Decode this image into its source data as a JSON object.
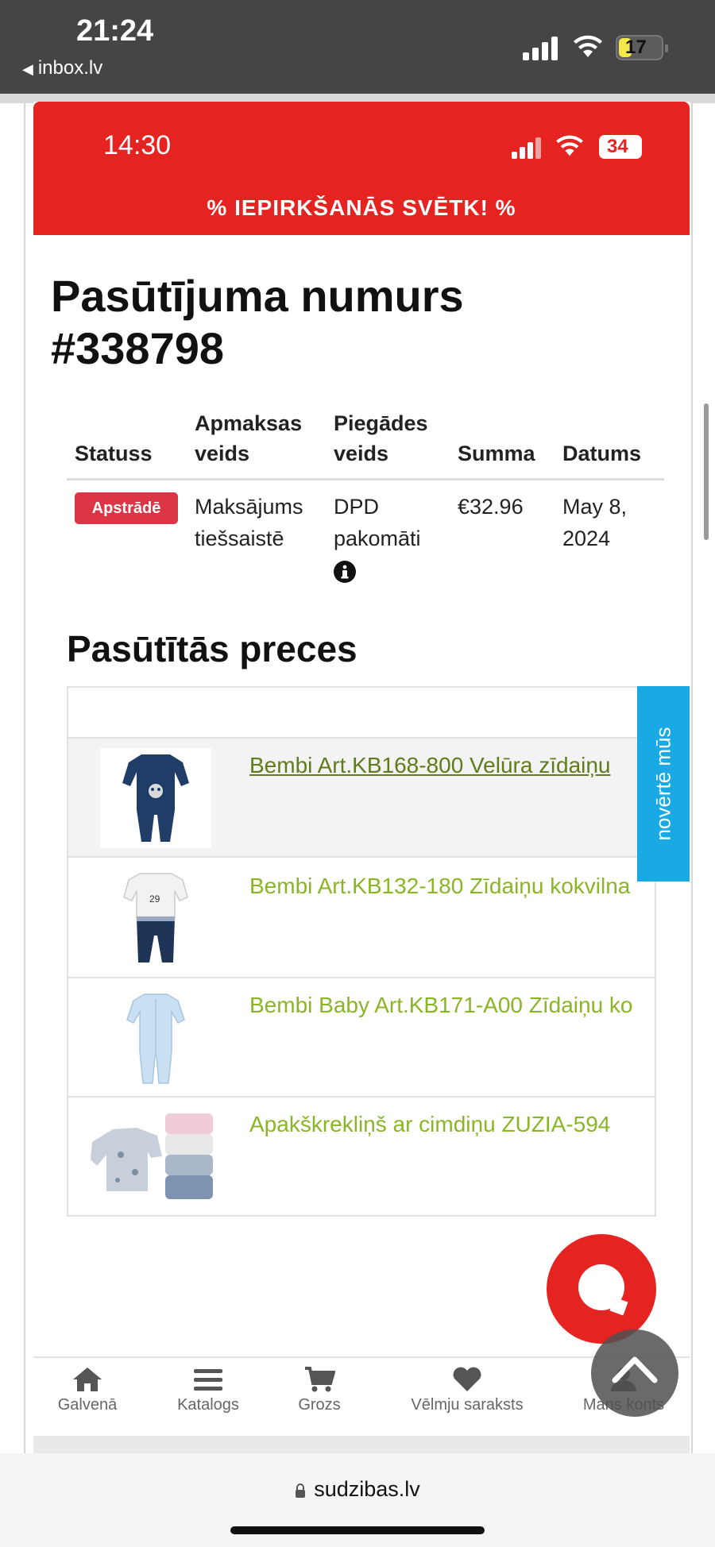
{
  "outer_status": {
    "time": "21:24",
    "back_app": "inbox.lv",
    "battery": "17"
  },
  "inner_status": {
    "time": "14:30",
    "battery": "34"
  },
  "promo_banner": "% IEPIRKŠANĀS SVĒTK! %",
  "order": {
    "title_line1": "Pasūtījuma numurs",
    "title_line2": "#338798",
    "headers": {
      "status": "Statuss",
      "payment_line1": "Apmaksas",
      "payment_line2": "veids",
      "delivery_line1": "Piegādes",
      "delivery_line2": "veids",
      "sum": "Summa",
      "date": "Datums"
    },
    "status_badge": "Apstrādē",
    "payment_line1": "Maksājums",
    "payment_line2": "tiešsaistē",
    "delivery_line1": "DPD",
    "delivery_line2": "pakomāti",
    "sum": "€32.96",
    "date_line1": "May 8,",
    "date_line2": "2024"
  },
  "products": {
    "title": "Pasūtītās preces",
    "items": [
      {
        "name": "Bembi Art.KB168-800 Velūra zīdaiņu"
      },
      {
        "name": "Bembi Art.KB132-180 Zīdaiņu kokvilna"
      },
      {
        "name": "Bembi Baby Art.KB171-A00 Zīdaiņu ko"
      },
      {
        "name": "Apakškrekliņš ar cimdiņu ZUZIA-594"
      }
    ]
  },
  "rate_tab": "novērtē mūs",
  "bottom_nav": [
    {
      "label": "Galvenā",
      "icon": "home-icon"
    },
    {
      "label": "Katalogs",
      "icon": "menu-icon"
    },
    {
      "label": "Grozs",
      "icon": "cart-icon"
    },
    {
      "label": "Vēlmju saraksts",
      "icon": "heart-icon"
    },
    {
      "label": "Mans konts",
      "icon": "user-icon"
    }
  ],
  "url": "sudzibas.lv",
  "colors": {
    "brand_red": "#e52421",
    "product_link": "#8ab526",
    "rate_tab": "#19a9e5",
    "status_badge": "#dc3545"
  }
}
